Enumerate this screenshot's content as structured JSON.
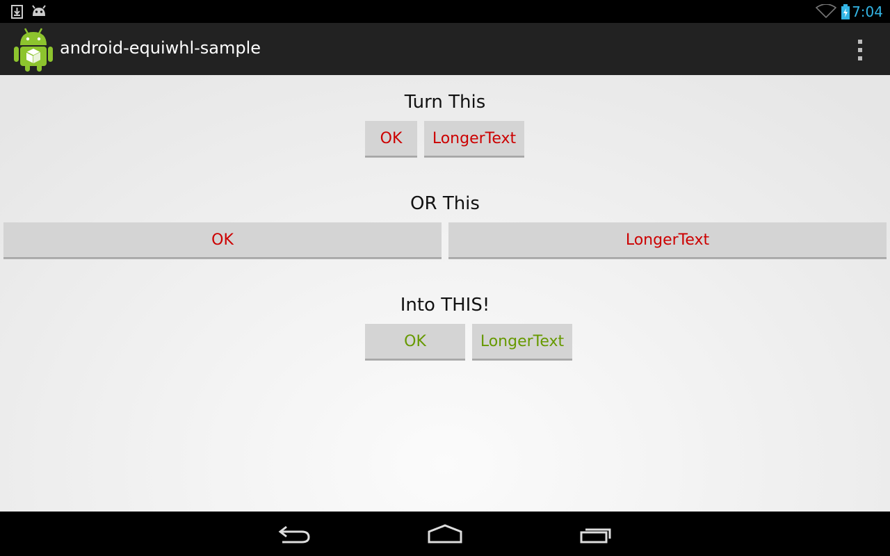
{
  "status_bar": {
    "time": "7:04",
    "notification_icons": [
      "download-icon",
      "android-debug-icon"
    ],
    "accent": "#33b5e5"
  },
  "action_bar": {
    "title": "android-equiwhl-sample",
    "app_icon": "android-robot-icon",
    "overflow_icon": "overflow-menu-icon"
  },
  "sections": [
    {
      "heading": "Turn This",
      "buttons": [
        "OK",
        "LongerText"
      ],
      "color": "#cc0000"
    },
    {
      "heading": "OR This",
      "buttons": [
        "OK",
        "LongerText"
      ],
      "color": "#cc0000"
    },
    {
      "heading": "Into THIS!",
      "buttons": [
        "OK",
        "LongerText"
      ],
      "color": "#669900"
    }
  ],
  "nav_bar": {
    "icons": [
      "back-icon",
      "home-icon",
      "recents-icon"
    ]
  }
}
